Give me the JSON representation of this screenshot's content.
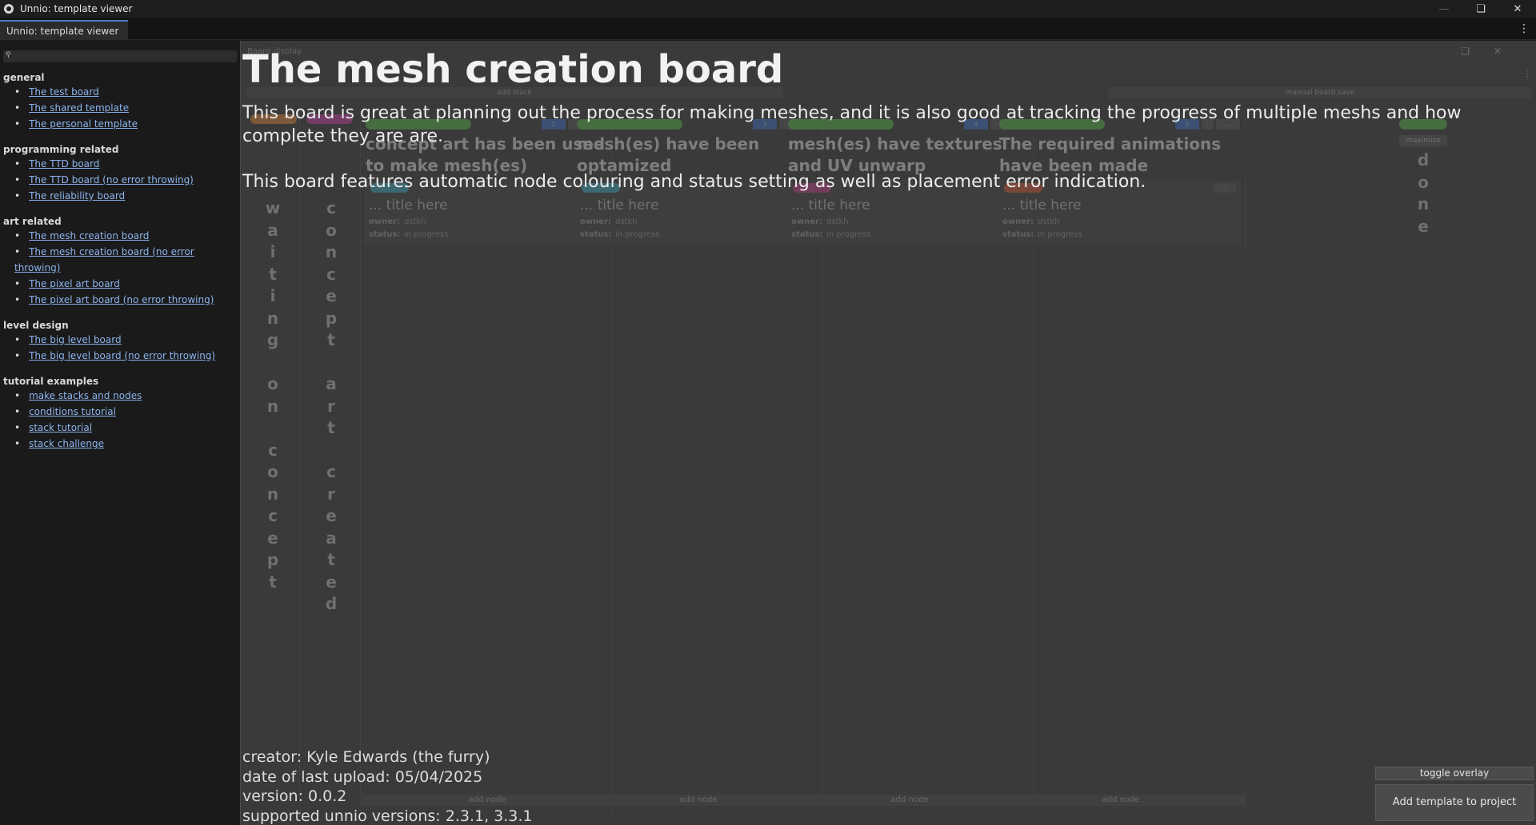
{
  "window": {
    "title": "Unnio: template viewer"
  },
  "tab": {
    "label": "Unnio: template viewer"
  },
  "sidebar": {
    "sections": [
      {
        "title": "general",
        "links": [
          "The test board",
          "The shared template",
          "The personal template"
        ]
      },
      {
        "title": "programming related",
        "links": [
          "The TTD board",
          "The TTD board (no error throwing)",
          "The reliability board"
        ]
      },
      {
        "title": "art related",
        "links": [
          "The mesh creation board",
          "The mesh creation board (no error throwing)",
          "The pixel art board",
          "The pixel art board (no error throwing)"
        ]
      },
      {
        "title": "level design",
        "links": [
          "The big level board",
          "The big level board (no error throwing)"
        ]
      },
      {
        "title": "tutorial examples",
        "links": [
          "make stacks and nodes",
          "conditions tutorial",
          "stack tutorial",
          "stack challenge"
        ]
      }
    ]
  },
  "board": {
    "header": "Board display",
    "add_stack_label": "add stack",
    "save_label": "manual board save",
    "waiting_column": {
      "text": "waiting on concept",
      "color": "#d9843a"
    },
    "concept_column": {
      "text": "concept art created",
      "color": "#c03fa0"
    },
    "stacks": [
      {
        "title": "concept art has been used to make mesh(es)",
        "count": "2",
        "node_color": "#3fa8c0"
      },
      {
        "title": "mesh(es) have been optamized",
        "count": "3",
        "node_color": "#3fa8c0"
      },
      {
        "title": "mesh(es) have textures and UV unwarp",
        "count": "4",
        "node_color": "#c03f8a"
      },
      {
        "title": "The required animations have been made",
        "count": "5",
        "node_color": "#d05a3a"
      }
    ],
    "node": {
      "title": "... title here",
      "owner_label": "owner:",
      "owner": "dstkh",
      "status_label": "status:",
      "status": "in progress",
      "more_label": "..."
    },
    "add_node_label": "add node",
    "done_column": {
      "maximize_label": "maximize",
      "text": "done"
    }
  },
  "overlay": {
    "title": "The mesh creation board",
    "description": [
      "This board is great at planning out the process for making meshes, and it is also good at tracking the progress of multiple meshs and how complete they are are.",
      "This board features automatic node colouring and status setting as well as placement error indication."
    ],
    "creator": "creator: Kyle Edwards (the furry)",
    "upload_date": "date of last upload: 05/04/2025",
    "version": "version: 0.0.2",
    "supported": "supported unnio versions: 2.3.1, 3.3.1",
    "toggle_label": "toggle overlay",
    "add_label": "Add template to project"
  }
}
